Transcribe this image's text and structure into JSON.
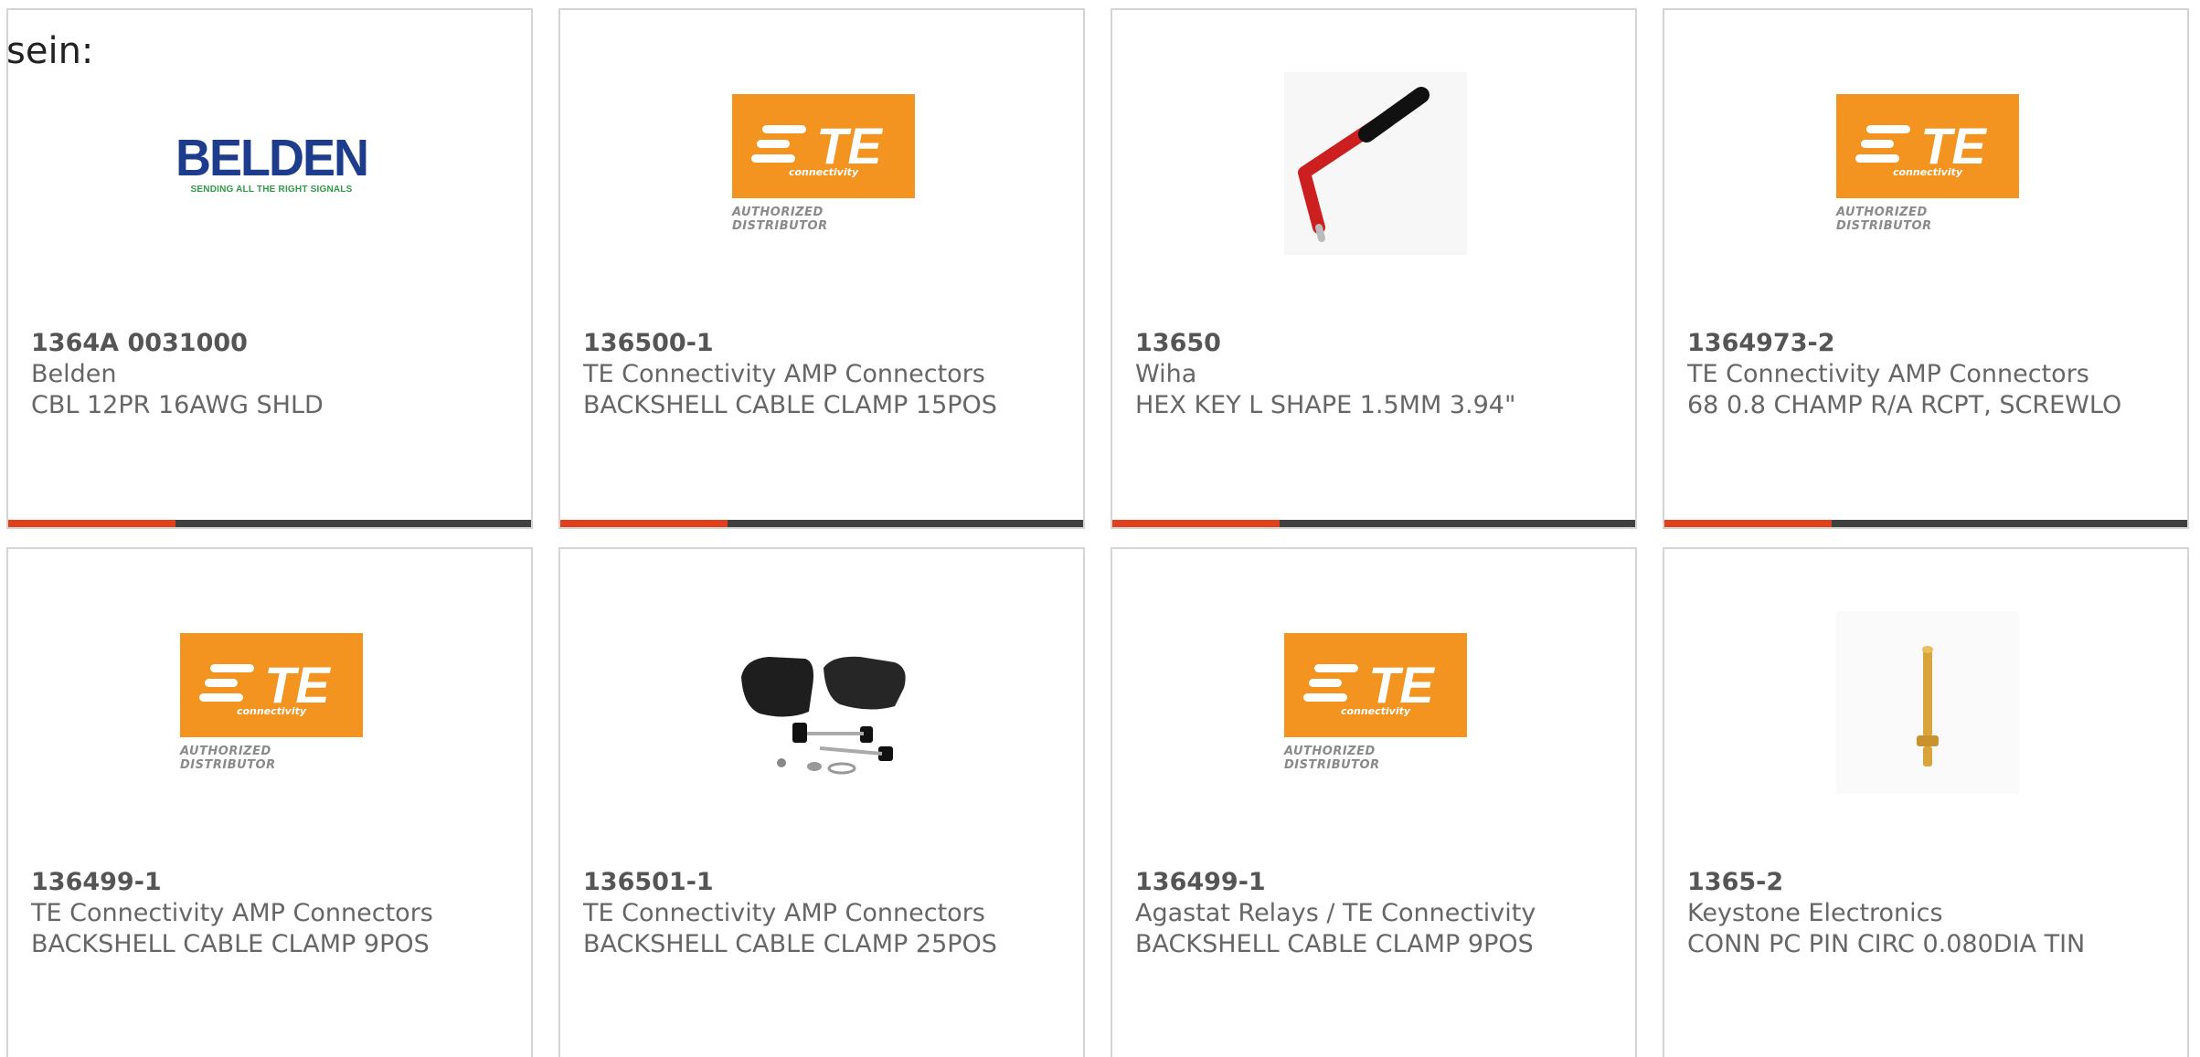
{
  "intro_text": "sein:",
  "colors": {
    "accent": "#e0401c",
    "bar_track": "#404040",
    "te_orange": "#f39320",
    "belden_blue": "#1d3c8c",
    "belden_green": "#2f9a48"
  },
  "logos": {
    "te_letters": "TE",
    "te_connectivity": "connectivity",
    "te_distributor": "AUTHORIZED DISTRIBUTOR",
    "belden_word": "BELDEN",
    "belden_tagline": "SENDING ALL THE RIGHT SIGNALS"
  },
  "products": [
    {
      "part": "1364A 0031000",
      "brand": "Belden",
      "description": "CBL 12PR 16AWG SHLD",
      "image": "belden-logo",
      "progress": 0.32
    },
    {
      "part": "136500-1",
      "brand": "TE Connectivity AMP Connectors",
      "description": "BACKSHELL CABLE CLAMP 15POS",
      "image": "te-logo",
      "progress": 0.32
    },
    {
      "part": "13650",
      "brand": "Wiha",
      "description": "HEX KEY L SHAPE 1.5MM 3.94\"",
      "image": "hex-key-photo",
      "progress": 0.32
    },
    {
      "part": "1364973-2",
      "brand": "TE Connectivity AMP Connectors",
      "description": "68 0.8 CHAMP R/A RCPT, SCREWLO",
      "image": "te-logo",
      "progress": 0.32
    },
    {
      "part": "136499-1",
      "brand": "TE Connectivity AMP Connectors",
      "description": "BACKSHELL CABLE CLAMP 9POS",
      "image": "te-logo",
      "progress": null
    },
    {
      "part": "136501-1",
      "brand": "TE Connectivity AMP Connectors",
      "description": "BACKSHELL CABLE CLAMP 25POS",
      "image": "backshell-photo",
      "progress": null
    },
    {
      "part": "136499-1",
      "brand": "Agastat Relays / TE Connectivity",
      "description": "BACKSHELL CABLE CLAMP 9POS",
      "image": "te-logo",
      "progress": null
    },
    {
      "part": "1365-2",
      "brand": "Keystone Electronics",
      "description": "CONN PC PIN CIRC 0.080DIA TIN",
      "image": "pin-photo",
      "progress": null
    }
  ]
}
